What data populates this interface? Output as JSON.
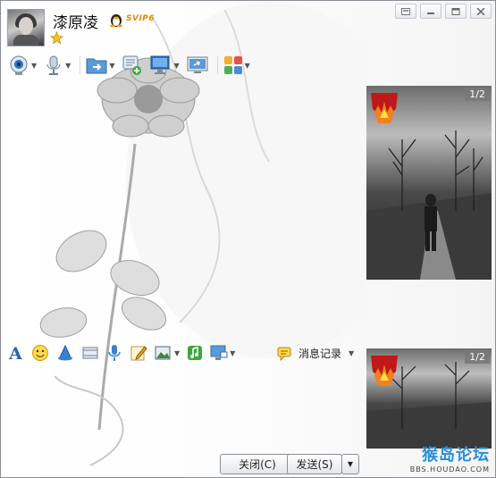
{
  "header": {
    "contact_name": "漆原凌",
    "vip_badge": "SVIP6"
  },
  "window_controls": [
    "skin-icon",
    "minimize-icon",
    "maximize-icon",
    "close-icon"
  ],
  "toolbar_top": [
    {
      "name": "video-call-icon",
      "has_dropdown": true
    },
    {
      "name": "voice-call-icon",
      "has_dropdown": true
    },
    {
      "name": "send-file-icon",
      "has_dropdown": true
    },
    {
      "name": "create-group-icon",
      "has_dropdown": false
    },
    {
      "name": "remote-desktop-icon",
      "has_dropdown": true
    },
    {
      "name": "share-screen-icon",
      "has_dropdown": false
    },
    {
      "name": "apps-icon",
      "has_dropdown": true
    }
  ],
  "video_panels": [
    {
      "page": "1/2"
    },
    {
      "page": "1/2"
    }
  ],
  "input_toolbar": [
    "font-icon",
    "emoji-icon",
    "shake-icon",
    "scissors-icon",
    "voice-message-icon",
    "doodle-icon",
    "image-icon",
    "music-icon",
    "screenshot-icon"
  ],
  "history": {
    "label": "消息记录"
  },
  "buttons": {
    "close_label": "关闭(C)",
    "send_label": "发送(S)"
  },
  "watermark": {
    "title": "猴岛论坛",
    "url": "BBS.HOUDAO.COM"
  },
  "colors": {
    "accent_blue": "#2a8fd8",
    "vip_orange": "#e08a00",
    "window_border": "#8a8f96"
  }
}
